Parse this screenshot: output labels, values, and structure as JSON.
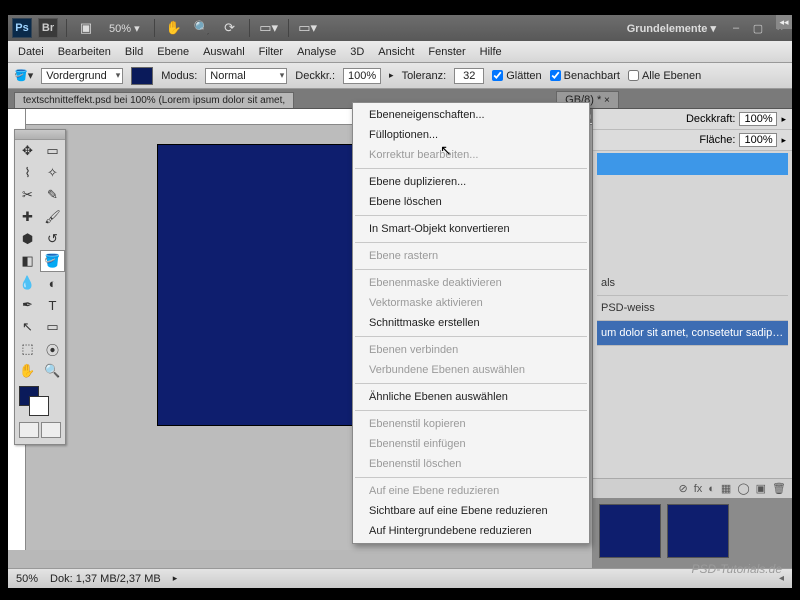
{
  "titlebar": {
    "zoom": "50%",
    "workspace": "Grundelemente ▾"
  },
  "menu": [
    "Datei",
    "Bearbeiten",
    "Bild",
    "Ebene",
    "Auswahl",
    "Filter",
    "Analyse",
    "3D",
    "Ansicht",
    "Fenster",
    "Hilfe"
  ],
  "options": {
    "fill_label": "Vordergrund",
    "mode_label": "Modus:",
    "mode_value": "Normal",
    "opacity_label": "Deckkr.:",
    "opacity_value": "100%",
    "tolerance_label": "Toleranz:",
    "tolerance_value": "32",
    "antialias": "Glätten",
    "contiguous": "Benachbart",
    "all_layers": "Alle Ebenen"
  },
  "tabs": {
    "main": "textschnitteffekt.psd bei 100% (Lorem ipsum dolor sit amet,",
    "second": "GB/8) *"
  },
  "context_menu": [
    {
      "t": "Ebeneneigenschaften...",
      "d": false
    },
    {
      "t": "Fülloptionen...",
      "d": false
    },
    {
      "t": "Korrektur bearbeiten...",
      "d": true
    },
    {
      "sep": true
    },
    {
      "t": "Ebene duplizieren...",
      "d": false
    },
    {
      "t": "Ebene löschen",
      "d": false
    },
    {
      "sep": true
    },
    {
      "t": "In Smart-Objekt konvertieren",
      "d": false
    },
    {
      "sep": true
    },
    {
      "t": "Ebene rastern",
      "d": true
    },
    {
      "sep": true
    },
    {
      "t": "Ebenenmaske deaktivieren",
      "d": true
    },
    {
      "t": "Vektormaske aktivieren",
      "d": true
    },
    {
      "t": "Schnittmaske erstellen",
      "d": false
    },
    {
      "sep": true
    },
    {
      "t": "Ebenen verbinden",
      "d": true
    },
    {
      "t": "Verbundene Ebenen auswählen",
      "d": true
    },
    {
      "sep": true
    },
    {
      "t": "Ähnliche Ebenen auswählen",
      "d": false
    },
    {
      "sep": true
    },
    {
      "t": "Ebenenstil kopieren",
      "d": true
    },
    {
      "t": "Ebenenstil einfügen",
      "d": true
    },
    {
      "t": "Ebenenstil löschen",
      "d": true
    },
    {
      "sep": true
    },
    {
      "t": "Auf eine Ebene reduzieren",
      "d": true
    },
    {
      "t": "Sichtbare auf eine Ebene reduzieren",
      "d": false
    },
    {
      "t": "Auf Hintergrundebene reduzieren",
      "d": false
    }
  ],
  "layers_panel": {
    "opacity_label": "Deckkraft:",
    "opacity_value": "100%",
    "fill_label": "Fläche:",
    "fill_value": "100%",
    "items": [
      {
        "label": "als",
        "sel": false
      },
      {
        "label": "PSD-weiss",
        "sel": false
      },
      {
        "label": "um dolor sit amet, consetetur sadips...",
        "sel": true
      }
    ],
    "icons": [
      "⊘",
      "fx",
      "◐",
      "▦",
      "◯",
      "▣",
      "🗑"
    ]
  },
  "status": {
    "zoom": "50%",
    "doc": "Dok: 1,37 MB/2,37 MB"
  },
  "watermark": "PSD-Tutorials.de",
  "colors": {
    "canvas": "#0e1e6e"
  }
}
